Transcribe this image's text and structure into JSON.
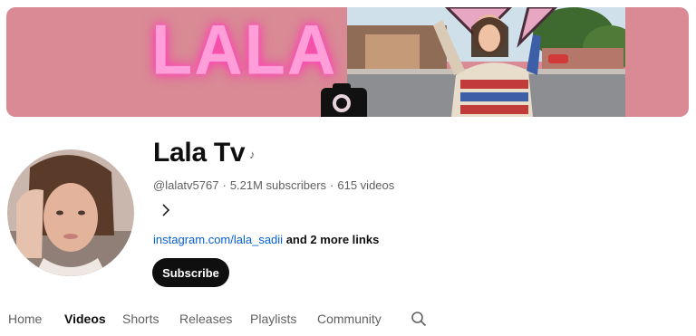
{
  "banner": {
    "title": "LALA TV"
  },
  "channel": {
    "name": "Lala Tv",
    "handle": "@lalatv5767",
    "subscribers": "5.21M subscribers",
    "videos": "615 videos",
    "separator": "·",
    "link": "instagram.com/lala_sadii",
    "more_links": "and 2 more links",
    "subscribe_label": "Subscribe"
  },
  "tabs": [
    {
      "label": "Home",
      "active": false
    },
    {
      "label": "Videos",
      "active": true
    },
    {
      "label": "Shorts",
      "active": false
    },
    {
      "label": "Releases",
      "active": false
    },
    {
      "label": "Playlists",
      "active": false
    },
    {
      "label": "Community",
      "active": false
    }
  ],
  "icons": {
    "music": "music-note-icon",
    "chevron": "chevron-right-icon",
    "search": "search-icon",
    "camera": "camera-icon"
  },
  "colors": {
    "banner_bg": "#d98a95",
    "banner_text": "#ff9ed9",
    "link": "#065fd4",
    "subscribe_bg": "#0f0f0f"
  }
}
